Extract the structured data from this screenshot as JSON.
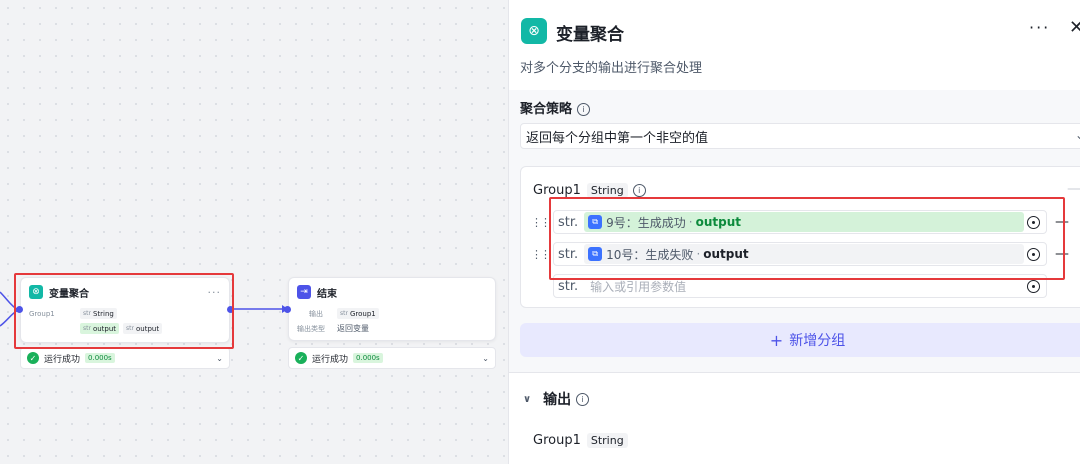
{
  "canvas": {
    "node_aggregate": {
      "title": "变量聚合",
      "more": "···",
      "group_label": "Group1",
      "group_type": "String",
      "type_prefix": "str",
      "var1": "output",
      "var2": "output"
    },
    "node_end": {
      "title": "结束",
      "output_label": "输出",
      "output_var": "Group1",
      "output_type_label": "输出类型",
      "output_type_value": "返回变量"
    },
    "status_1": {
      "text": "运行成功",
      "time": "0.000s"
    },
    "status_2": {
      "text": "运行成功",
      "time": "0.000s"
    }
  },
  "panel": {
    "title": "变量聚合",
    "more": "···",
    "close": "✕",
    "description": "对多个分支的输出进行聚合处理",
    "strategy": {
      "label": "聚合策略",
      "value": "返回每个分组中第一个非空的值"
    },
    "group": {
      "name": "Group1",
      "type": "String",
      "rows": [
        {
          "type": "str.",
          "node": "9号：生成成功",
          "var": "output",
          "state": "success"
        },
        {
          "type": "str.",
          "node": "10号：生成失败",
          "var": "output",
          "state": "fail"
        }
      ],
      "empty_row": {
        "type": "str.",
        "placeholder": "输入或引用参数值"
      }
    },
    "add_group_label": "新增分组",
    "output": {
      "label": "输出",
      "var_name": "Group1",
      "var_type": "String"
    }
  },
  "colors": {
    "accent": "#4d53e8",
    "success": "#19b05a",
    "highlight_border": "#e5393b",
    "teal_icon": "#12b8a6"
  }
}
